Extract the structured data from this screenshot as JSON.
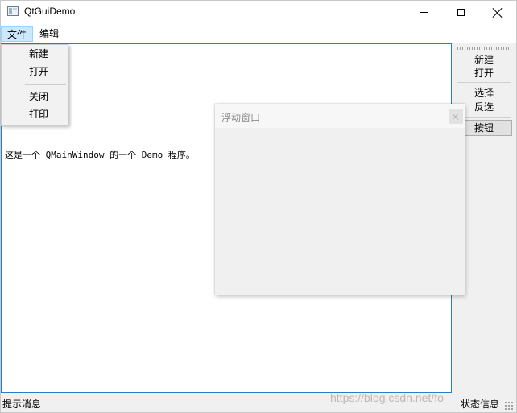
{
  "window": {
    "title": "QtGuiDemo",
    "icons": {
      "app": "app-window-icon",
      "minimize": "minimize-icon",
      "maximize": "maximize-icon",
      "close": "close-icon"
    }
  },
  "menubar": {
    "items": [
      {
        "label": "文件"
      },
      {
        "label": "编辑"
      }
    ]
  },
  "file_menu": {
    "items": [
      {
        "label": "新建"
      },
      {
        "label": "打开"
      },
      {
        "label": "关闭"
      },
      {
        "label": "打印"
      }
    ]
  },
  "central": {
    "text": "这是一个 QMainWindow 的一个 Demo 程序。"
  },
  "toolbar": {
    "items": [
      {
        "label": "新建"
      },
      {
        "label": "打开"
      },
      {
        "label": "选择"
      },
      {
        "label": "反选"
      }
    ],
    "button_label": "按钮"
  },
  "dock": {
    "title": "浮动窗口"
  },
  "statusbar": {
    "message": "提示消息",
    "permanent": "状态信息"
  },
  "watermark": "https://blog.csdn.net/fo",
  "colors": {
    "menu_highlight": "#cce8ff",
    "focus_border": "#2b7bc5",
    "background": "#f0f0f0"
  }
}
